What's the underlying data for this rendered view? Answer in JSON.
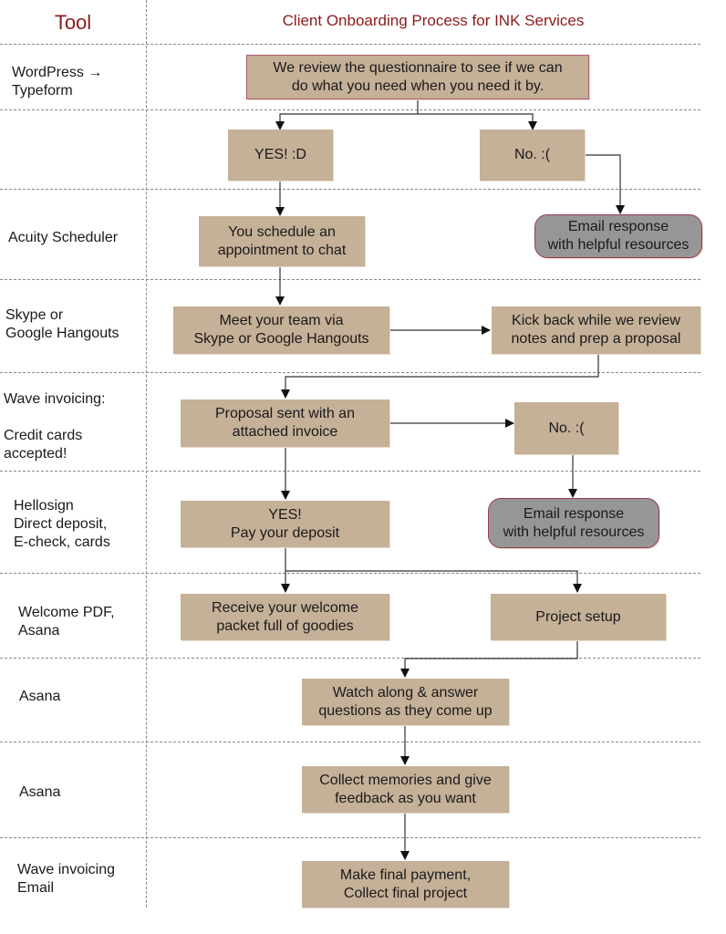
{
  "header": {
    "tool_column": "Tool",
    "title": "Client Onboarding Process for INK Services"
  },
  "tools": [
    "WordPress →\nTypeform",
    "",
    "Acuity Scheduler",
    "Skype or\nGoogle Hangouts",
    "Wave invoicing:\n\nCredit cards\naccepted!",
    "Hellosign\nDirect deposit,\nE-check, cards",
    "Welcome PDF,\nAsana",
    "Asana",
    "Asana",
    "Wave invoicing\nEmail"
  ],
  "steps": {
    "review": "We review the questionnaire to see if we can\ndo what you need when you need it by.",
    "yes1": "YES! :D",
    "no1": "No. :(",
    "schedule": "You schedule an\nappointment to chat",
    "email1": "Email response\nwith helpful resources",
    "meet": "Meet your team via\nSkype or Google Hangouts",
    "kickback": "Kick back while we review\nnotes and prep a proposal",
    "proposal": "Proposal sent with an\nattached invoice",
    "no2": "No. :(",
    "yes2": "YES!\nPay your deposit",
    "email2": "Email response\nwith helpful resources",
    "welcome": "Receive your welcome\npacket full of goodies",
    "setup": "Project setup",
    "watch": "Watch along & answer\nquestions as they come up",
    "collect": "Collect memories and give\nfeedback as you want",
    "final": "Make final payment,\nCollect final project"
  },
  "colors": {
    "step_fill": "#c5b098",
    "end_fill": "#969696",
    "title": "#8b1a1a"
  }
}
